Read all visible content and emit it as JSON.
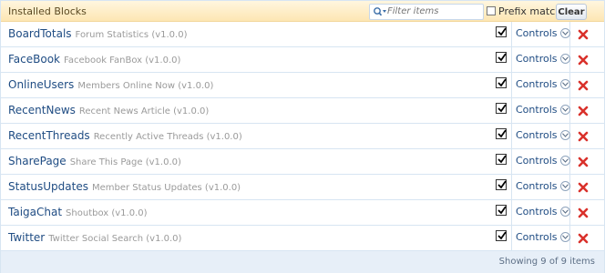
{
  "header": {
    "title": "Installed Blocks",
    "filter_placeholder": "Filter items",
    "prefix_label": "Prefix match",
    "clear_label": "Clear"
  },
  "rows": [
    {
      "name": "BoardTotals",
      "desc": "Forum Statistics (v1.0.0)",
      "controls": "Controls"
    },
    {
      "name": "FaceBook",
      "desc": "Facebook FanBox (v1.0.0)",
      "controls": "Controls"
    },
    {
      "name": "OnlineUsers",
      "desc": "Members Online Now (v1.0.0)",
      "controls": "Controls"
    },
    {
      "name": "RecentNews",
      "desc": "Recent News Article (v1.0.0)",
      "controls": "Controls"
    },
    {
      "name": "RecentThreads",
      "desc": "Recently Active Threads (v1.0.0)",
      "controls": "Controls"
    },
    {
      "name": "SharePage",
      "desc": "Share This Page (v1.0.0)",
      "controls": "Controls"
    },
    {
      "name": "StatusUpdates",
      "desc": "Member Status Updates (v1.0.0)",
      "controls": "Controls"
    },
    {
      "name": "TaigaChat",
      "desc": "Shoutbox (v1.0.0)",
      "controls": "Controls"
    },
    {
      "name": "Twitter",
      "desc": "Twitter Social Search (v1.0.0)",
      "controls": "Controls"
    }
  ],
  "footer": {
    "status": "Showing 9 of 9 items"
  },
  "icons": {
    "filter": "search-icon",
    "controls": "chevron-down-icon",
    "delete": "delete-icon"
  },
  "colors": {
    "header_bg": "#fde6b3",
    "link": "#1f4c83",
    "desc": "#9a9a9a",
    "delete": "#d9312b"
  }
}
